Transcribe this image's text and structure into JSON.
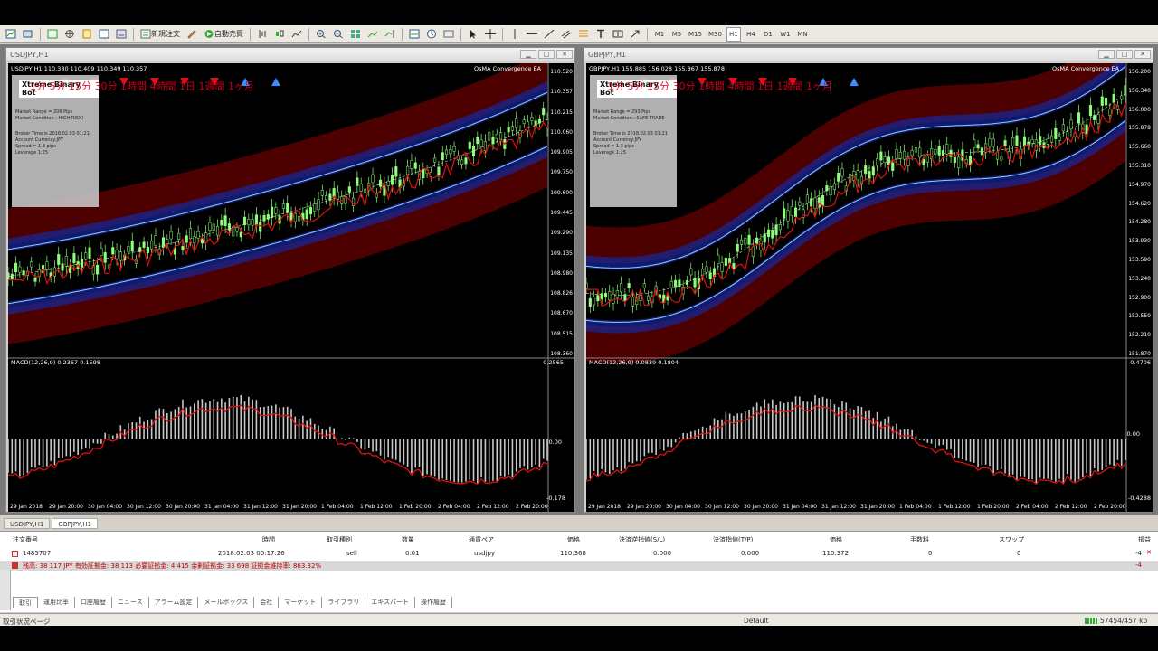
{
  "toolbar": {
    "new_order": "新規注文",
    "auto_trade": "自動売買",
    "timeframes": [
      "M1",
      "M5",
      "M15",
      "M30",
      "H1",
      "H4",
      "D1",
      "W1",
      "MN"
    ]
  },
  "left_chart": {
    "window_title": "USDJPY,H1",
    "symbol_header": "USDJPY,H1  110.380 110.409 110.349 110.357",
    "indicator_name": "OsMA Convergence EA",
    "red_overlay_text": "1分 5分 15分 30分 1時間 4時間 1日 1週間 1ヶ月",
    "panel": {
      "title": "Xtreme Binary Bot",
      "lines": [
        "Market Range = 206 Pips",
        "Market Condition : HIGH RISK!",
        "Broker Time is 2018.02.03 01:21",
        "Account Currency:JPY",
        "Spread = 1.3 pips",
        "Leverage 1:25"
      ]
    },
    "price_labels": [
      "110.520",
      "110.357",
      "110.215",
      "110.060",
      "109.905",
      "109.750",
      "109.600",
      "109.445",
      "109.290",
      "109.135",
      "108.980",
      "108.826",
      "108.670",
      "108.515",
      "108.360"
    ],
    "macd_label": "MACD(12,26,9) 0.2367 0.1598",
    "macd_scale": [
      "0.2565",
      "0.00",
      "-0.178"
    ],
    "time_labels": [
      "29 Jan 2018",
      "29 Jan 20:00",
      "30 Jan 04:00",
      "30 Jan 12:00",
      "30 Jan 20:00",
      "31 Jan 04:00",
      "31 Jan 12:00",
      "31 Jan 20:00",
      "1 Feb 04:00",
      "1 Feb 12:00",
      "1 Feb 20:00",
      "2 Feb 04:00",
      "2 Feb 12:00",
      "2 Feb 20:00"
    ]
  },
  "right_chart": {
    "window_title": "GBPJPY,H1",
    "symbol_header": "GBPJPY,H1  155.885 156.028 155.867 155.878",
    "indicator_name": "OsMA Convergence EA",
    "red_overlay_text": "1分 5分 15分 30分 1時間 4時間 1日 1週間 1ヶ月",
    "panel": {
      "title": "Xtreme Binary Bot",
      "lines": [
        "Market Range = 293 Pips",
        "Market Condition : SAFE TRADE",
        "Broker Time is 2018.02.03 01:21",
        "Account Currency:JPY",
        "Spread = 1.3 pips",
        "Leverage 1:25"
      ]
    },
    "price_labels": [
      "156.200",
      "156.340",
      "156.000",
      "155.878",
      "155.660",
      "155.310",
      "154.970",
      "154.620",
      "154.280",
      "153.930",
      "153.590",
      "153.240",
      "152.900",
      "152.550",
      "152.210",
      "151.870"
    ],
    "macd_label": "MACD(12,26,9) 0.0839 0.1804",
    "macd_scale": [
      "0.4706",
      "0.00",
      "-0.4288"
    ],
    "time_labels": [
      "29 Jan 2018",
      "29 Jan 20:00",
      "30 Jan 04:00",
      "30 Jan 12:00",
      "30 Jan 20:00",
      "31 Jan 04:00",
      "31 Jan 12:00",
      "31 Jan 20:00",
      "1 Feb 04:00",
      "1 Feb 12:00",
      "1 Feb 20:00",
      "2 Feb 04:00",
      "2 Feb 12:00",
      "2 Feb 20:00"
    ]
  },
  "chart_tabs": [
    "USDJPY,H1",
    "GBPJPY,H1"
  ],
  "terminal": {
    "headers": [
      "注文番号",
      "時間",
      "取引種別",
      "数量",
      "通貨ペア",
      "価格",
      "決済逆指値(S/L)",
      "決済指値(T/P)",
      "価格",
      "手数料",
      "スワップ",
      "損益"
    ],
    "order": {
      "id": "1485707",
      "time": "2018.02.03 00:17:26",
      "type": "sell",
      "volume": "0.01",
      "symbol": "usdjpy",
      "price": "110.368",
      "sl": "0.000",
      "tp": "0.000",
      "current_price": "110.372",
      "commission": "0",
      "swap": "0",
      "profit": "-4"
    },
    "balance_line": "残高: 38 117 JPY  有効証拠金: 38 113  必要証拠金: 4 415  余剰証拠金: 33 698  証拠金維持率: 863.32%",
    "balance_profit": "-4",
    "bottom_tabs": [
      "取引",
      "運用比率",
      "口座履歴",
      "ニュース",
      "アラーム設定",
      "メールボックス",
      "会社",
      "マーケット",
      "ライブラリ",
      "エキスパート",
      "操作履歴"
    ]
  },
  "status": {
    "left": "取引状況ページ",
    "profile": "Default",
    "traffic": "57454/457 kb"
  },
  "colors": {
    "candle_up": "#8fff7a",
    "band_red": "#5a0000",
    "band_blue": "#1428a0",
    "ma_red": "#e01010",
    "macd_bar": "#c8c8c8"
  }
}
